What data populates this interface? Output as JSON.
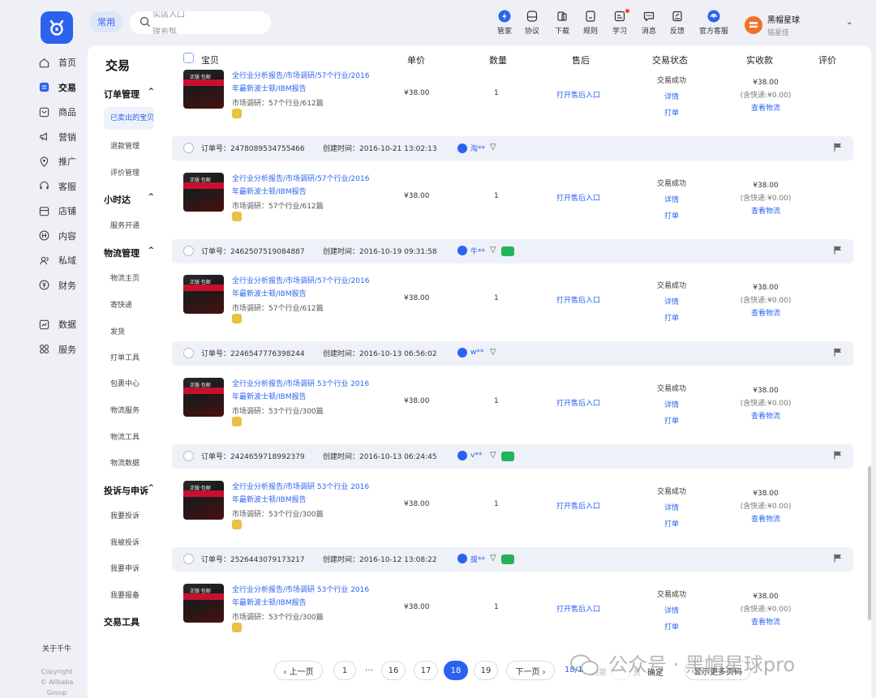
{
  "top": {
    "common_label": "常用",
    "search_placeholder_1": "实店入口",
    "search_placeholder_2": "搜索框",
    "nav": [
      {
        "label": "管家",
        "icon": "butler-icon"
      },
      {
        "label": "协议",
        "icon": "agreement-icon"
      },
      {
        "label": "下载",
        "icon": "download-icon"
      },
      {
        "label": "规则",
        "icon": "rules-icon"
      },
      {
        "label": "学习",
        "icon": "learn-icon"
      },
      {
        "label": "消息",
        "icon": "message-icon"
      },
      {
        "label": "反馈",
        "icon": "feedback-icon"
      },
      {
        "label": "官方客服",
        "icon": "support-icon"
      }
    ],
    "user_name": "黑帽星球",
    "user_sub": "铭星佳"
  },
  "leftnav": [
    {
      "label": "首页",
      "icon": "home-icon"
    },
    {
      "label": "交易",
      "icon": "trade-icon",
      "active": true
    },
    {
      "label": "商品",
      "icon": "goods-icon"
    },
    {
      "label": "营销",
      "icon": "marketing-icon"
    },
    {
      "label": "推广",
      "icon": "promotion-icon"
    },
    {
      "label": "客服",
      "icon": "customer-service-icon"
    },
    {
      "label": "店铺",
      "icon": "shop-icon"
    },
    {
      "label": "内容",
      "icon": "content-icon"
    },
    {
      "label": "私域",
      "icon": "private-domain-icon"
    },
    {
      "label": "财务",
      "icon": "finance-icon"
    },
    {
      "label": "数据",
      "icon": "data-icon"
    },
    {
      "label": "服务",
      "icon": "service-icon"
    }
  ],
  "about": "关于千牛",
  "copyright_1": "Copyright",
  "copyright_2": "© Alibaba Group",
  "subnav": {
    "title": "交易",
    "groups": [
      {
        "label": "订单管理",
        "items": [
          "已卖出的宝贝",
          "退款管理",
          "评价管理"
        ]
      },
      {
        "label": "小时达",
        "items": [
          "服务开通"
        ]
      },
      {
        "label": "物流管理",
        "items": [
          "物流主页",
          "寄快递",
          "发货",
          "打单工具",
          "包裹中心",
          "物流服务",
          "物流工具",
          "物流数据"
        ]
      },
      {
        "label": "投诉与申诉",
        "items": [
          "我要投诉",
          "我被投诉",
          "我要申诉",
          "我要报备"
        ]
      },
      {
        "label": "交易工具",
        "items": []
      }
    ]
  },
  "table": {
    "headers": [
      "宝贝",
      "单价",
      "数量",
      "售后",
      "交易状态",
      "实收款",
      "评价"
    ]
  },
  "orders": [
    {
      "order_no": "",
      "time": "",
      "buyer": "",
      "chat": false,
      "title": "全行业分析报告/市场调研/57个行业/2016年最新波士顿/IBM报告",
      "spec": "市场调研：57个行业/612篇"
    },
    {
      "order_no": "订单号：2478089534755466",
      "time": "创建时间：2016-10-21 13:02:13",
      "buyer": "淘**",
      "chat": false,
      "title": "全行业分析报告/市场调研/57个行业/2016年最新波士顿/IBM报告",
      "spec": "市场调研：57个行业/612篇"
    },
    {
      "order_no": "订单号：2462507519084887",
      "time": "创建时间：2016-10-19 09:31:58",
      "buyer": "牛**",
      "chat": true,
      "title": "全行业分析报告/市场调研/57个行业/2016年最新波士顿/IBM报告",
      "spec": "市场调研：57个行业/612篇"
    },
    {
      "order_no": "订单号：2246547776398244",
      "time": "创建时间：2016-10-13 06:56:02",
      "buyer": "w**",
      "chat": false,
      "title": "全行业分析报告/市场调研 53个行业 2016年最新波士顿/IBM报告",
      "spec": "市场调研：53个行业/300篇"
    },
    {
      "order_no": "订单号：2424659718992379",
      "time": "创建时间：2016-10-13 06:24:45",
      "buyer": "v**",
      "chat": true,
      "title": "全行业分析报告/市场调研 53个行业 2016年最新波士顿/IBM报告",
      "spec": "市场调研：53个行业/300篇"
    },
    {
      "order_no": "订单号：2526443079173217",
      "time": "创建时间：2016-10-12 13:08:22",
      "buyer": "拔**",
      "chat": true,
      "title": "全行业分析报告/市场调研 53个行业 2016年最新波士顿/IBM报告",
      "spec": "市场调研：53个行业/300篇"
    }
  ],
  "row_common": {
    "price": "¥38.00",
    "qty": "1",
    "after": "打开售后入口",
    "status": "交易成功",
    "detail": "详情",
    "print": "打单",
    "paid": "¥38.00",
    "shipping": "(含快递:¥0.00)",
    "logistics": "查看物流",
    "thumb_text": "正版·包邮"
  },
  "pagination": {
    "prev": "‹ 上一页",
    "pages": [
      "1",
      "…",
      "16",
      "17",
      "18",
      "19"
    ],
    "current": "18",
    "next": "下一页 ›",
    "position": "18/19",
    "goto_label": "到第",
    "page_unit": "页",
    "confirm": "确定",
    "more": "显示更多页码"
  },
  "watermark": "公众号 · 黑帽星球pro"
}
